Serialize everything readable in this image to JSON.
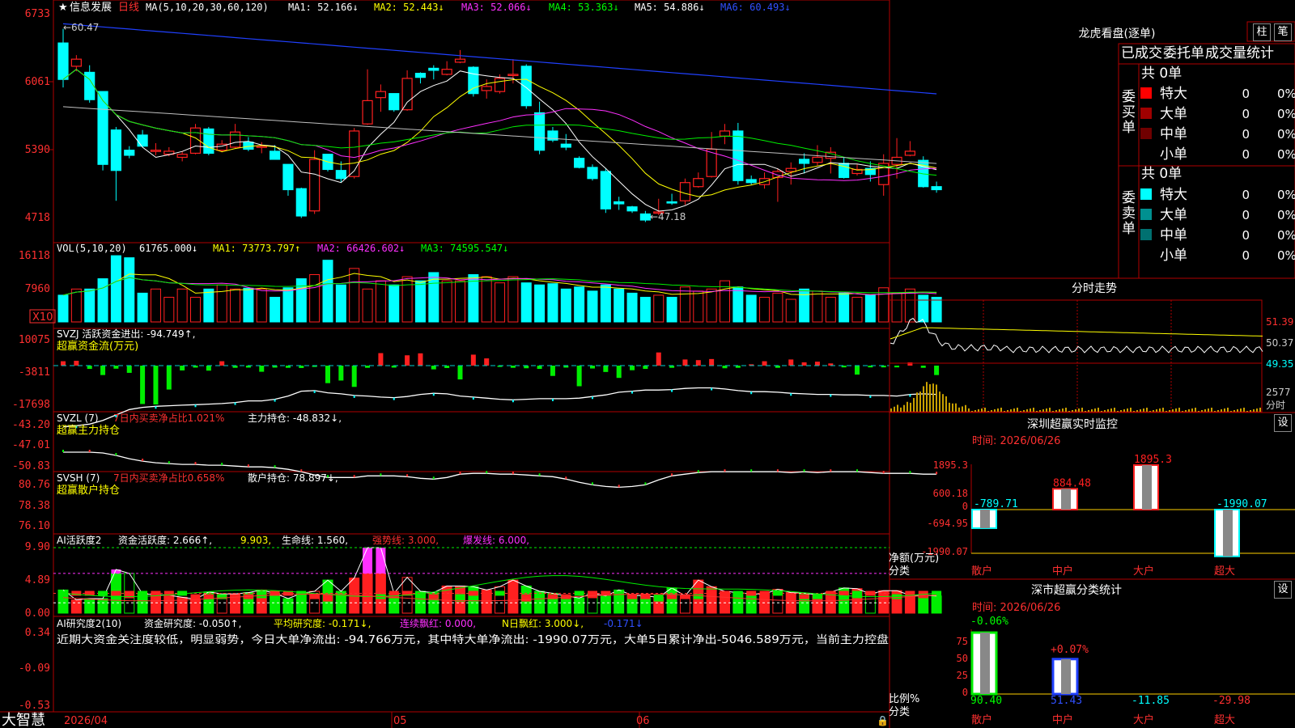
{
  "colors": {
    "up": "#ff2020",
    "down": "#00ffff",
    "green": "#00ee00",
    "magenta": "#ff30ff",
    "yellow": "#ffff00",
    "grid": "#b00000",
    "bg": "#000000"
  },
  "bottom_bar": {
    "brand": "大智慧",
    "date_start": "2026/04",
    "month_05": "05",
    "month_06": "06"
  },
  "main_chart": {
    "legend": {
      "star": "★",
      "name": "信息发展",
      "period": "日线",
      "ma_def": "MA(5,10,20,30,60,120)",
      "ma1": "MA1: 52.166↓",
      "ma2": "MA2: 52.443↓",
      "ma3": "MA3: 52.066↓",
      "ma4": "MA4: 53.363↓",
      "ma5": "MA5: 54.886↓",
      "ma6": "MA6: 60.493↓"
    },
    "y_ticks": [
      "6733",
      "6061",
      "5390",
      "4718"
    ],
    "high_label": "←60.47",
    "low_label": "←47.18"
  },
  "vol_chart": {
    "legend": {
      "def": "VOL(5,10,20)",
      "vol": "61765.000↓",
      "ma1": "MA1: 73773.797↑",
      "ma2": "MA2: 66426.602↓",
      "ma3": "MA3: 74595.547↓"
    },
    "y_ticks": [
      "16118",
      "7960"
    ],
    "unit": "X10"
  },
  "svzj": {
    "legend1": "SVZJ  活跃资金进出: -94.749↑,",
    "legend2": "超赢资金流(万元)",
    "y_ticks": [
      "10075",
      "-3811",
      "-17698"
    ]
  },
  "svzl": {
    "legend1_a": "SVZL (7)",
    "legend1_b": "7日内买卖净占比1.021%",
    "legend1_c": "主力持仓: -48.832↓,",
    "legend2": "超赢主力持仓",
    "y_ticks": [
      "-43.20",
      "-47.01",
      "-50.83"
    ]
  },
  "svsh": {
    "legend1_a": "SVSH (7)",
    "legend1_b": "7日内买卖净占比0.658%",
    "legend1_c": "散户持仓: 78.897↓,",
    "legend2": "超赢散户持仓",
    "y_ticks": [
      "80.76",
      "78.38",
      "76.10"
    ]
  },
  "ai2": {
    "l_a": "AI活跃度2",
    "l_b": "资金活跃度: 2.666↑,",
    "l_c": "9.903,",
    "l_d": "生命线: 1.560,",
    "l_e": "强势线: 3.000,",
    "l_f": "爆发线: 6.000,",
    "y_ticks": [
      "9.90",
      "4.89",
      "0.00"
    ]
  },
  "ai_res": {
    "l_a": "AI研究度2(10)",
    "l_b": "资金研究度: -0.050↑,",
    "l_c": "平均研究度: -0.171↓,",
    "l_d": "连续飘红: 0.000,",
    "l_e": "N日飘红: 3.000↓,",
    "l_f": "-0.171↓",
    "note": "近期大资金关注度较低，明显弱势，今日大单净流出: -94.766万元，其中特大单净流出: -1990.07万元，大单5日累计净出-5046.589万元，当前主力控盘",
    "y_ticks": [
      "0.34",
      "-0.09",
      "-0.53"
    ]
  },
  "right_panel": {
    "title": "龙虎看盘(逐单)",
    "btn_zhu": "柱",
    "btn_bi": "笔",
    "tabs": [
      "已成交",
      "委托单",
      "成交量统计"
    ],
    "buy": {
      "side": "委买单",
      "total": "共 0单",
      "rows": [
        {
          "name": "特大",
          "count": "0",
          "pct": "0%",
          "color": "#ff0000"
        },
        {
          "name": "大单",
          "count": "0",
          "pct": "0%",
          "color": "#a00000"
        },
        {
          "name": "中单",
          "count": "0",
          "pct": "0%",
          "color": "#700000"
        },
        {
          "name": "小单",
          "count": "0",
          "pct": "0%",
          "color": ""
        }
      ]
    },
    "sell": {
      "side": "委卖单",
      "total": "共 0单",
      "rows": [
        {
          "name": "特大",
          "count": "0",
          "pct": "0%",
          "color": "#00ffff"
        },
        {
          "name": "大单",
          "count": "0",
          "pct": "0%",
          "color": "#009090"
        },
        {
          "name": "中单",
          "count": "0",
          "pct": "0%",
          "color": "#007070"
        },
        {
          "name": "小单",
          "count": "0",
          "pct": "0%",
          "color": ""
        }
      ]
    },
    "intraday": {
      "title": "分时走势",
      "prices": [
        "51.39",
        "50.37",
        "49.35"
      ],
      "vol": "2577",
      "vol_unit": "分时"
    },
    "monitor": {
      "title": "深圳超赢实时监控",
      "date": "时间: 2026/06/26",
      "btn": "设",
      "y_ticks": [
        "1895.3",
        "600.18",
        "0",
        "-694.95",
        "-1990.07"
      ],
      "ylabel": "净额(万元)",
      "xlabel": "分类",
      "cats": [
        "散户",
        "中户",
        "大户",
        "超大"
      ],
      "values": [
        -789.71,
        884.48,
        1895.3,
        -1990.07
      ],
      "value_labels": [
        "-789.71",
        "884.48",
        "1895.3",
        "-1990.07"
      ]
    },
    "classify": {
      "title": "深市超赢分类统计",
      "date": "时间: 2026/06/26",
      "btn": "设",
      "y_ticks": [
        "75",
        "50",
        "25",
        "0"
      ],
      "ylabel": "比例%",
      "xlabel": "分类",
      "cats": [
        "散户",
        "中户",
        "大户",
        "超大"
      ],
      "top_labels": [
        "-0.06%",
        "+0.07%"
      ],
      "values": [
        "90.40",
        "51.43",
        "-11.85",
        "-29.98"
      ]
    }
  },
  "chart_data": [
    {
      "type": "candlestick",
      "title": "信息发展 日线",
      "y_ticks": [
        6733,
        6061,
        5390,
        4718
      ],
      "high": 60.47,
      "low": 47.18,
      "ohlc": [
        [
          64.6,
          66.0,
          60.2,
          61.0
        ],
        [
          62.3,
          63.4,
          61.8,
          63.0
        ],
        [
          61.7,
          62.4,
          58.7,
          59.0
        ],
        [
          59.8,
          59.8,
          52.0,
          52.6
        ],
        [
          56.0,
          56.3,
          49.0,
          52.0
        ],
        [
          54.0,
          54.4,
          53.2,
          53.5
        ],
        [
          55.5,
          56.0,
          54.3,
          54.4
        ],
        [
          54.0,
          54.7,
          53.5,
          54.0
        ],
        [
          53.6,
          54.3,
          53.4,
          53.9
        ],
        [
          53.3,
          53.9,
          52.9,
          53.6
        ],
        [
          53.7,
          56.6,
          53.6,
          56.2
        ],
        [
          56.1,
          56.3,
          53.5,
          53.7
        ],
        [
          54.0,
          55.0,
          53.8,
          54.6
        ],
        [
          54.3,
          56.6,
          54.2,
          55.8
        ],
        [
          54.8,
          55.3,
          53.9,
          54.1
        ],
        [
          54.3,
          54.8,
          53.7,
          54.4
        ],
        [
          53.9,
          54.5,
          53.1,
          53.1
        ],
        [
          52.6,
          52.6,
          49.5,
          50.1
        ],
        [
          50.2,
          50.3,
          47.3,
          47.5
        ],
        [
          48.0,
          54.0,
          47.7,
          53.1
        ],
        [
          53.6,
          53.6,
          51.9,
          52.1
        ],
        [
          52.0,
          52.9,
          50.8,
          51.2
        ],
        [
          51.4,
          56.2,
          51.2,
          55.9
        ],
        [
          56.6,
          62.0,
          56.5,
          58.9
        ],
        [
          59.2,
          60.5,
          57.8,
          59.8
        ],
        [
          59.6,
          59.6,
          57.8,
          58.0
        ],
        [
          58.0,
          61.9,
          57.9,
          61.1
        ],
        [
          61.6,
          61.7,
          60.6,
          61.2
        ],
        [
          62.1,
          62.4,
          61.0,
          61.9
        ],
        [
          61.5,
          62.8,
          61.4,
          62.0
        ],
        [
          62.7,
          63.9,
          62.6,
          63.0
        ],
        [
          62.2,
          62.3,
          59.3,
          59.6
        ],
        [
          59.9,
          61.0,
          59.1,
          60.3
        ],
        [
          59.8,
          61.5,
          59.6,
          61.1
        ],
        [
          61.4,
          63.0,
          60.6,
          61.5
        ],
        [
          62.3,
          62.5,
          58.1,
          58.4
        ],
        [
          57.7,
          58.8,
          53.6,
          54.0
        ],
        [
          55.9,
          56.3,
          54.8,
          55.0
        ],
        [
          54.6,
          55.6,
          54.0,
          54.3
        ],
        [
          53.2,
          53.4,
          52.2,
          52.3
        ],
        [
          52.3,
          52.6,
          51.0,
          51.2
        ],
        [
          51.9,
          52.2,
          47.8,
          48.2
        ],
        [
          48.9,
          49.4,
          48.1,
          48.7
        ],
        [
          48.4,
          48.5,
          47.8,
          48.0
        ],
        [
          47.7,
          48.0,
          46.9,
          47.1
        ],
        [
          47.9,
          49.2,
          47.6,
          47.9
        ],
        [
          48.9,
          49.7,
          48.6,
          48.8
        ],
        [
          49.0,
          51.2,
          48.6,
          50.8
        ],
        [
          50.4,
          51.8,
          50.3,
          51.2
        ],
        [
          51.4,
          55.8,
          51.3,
          54.1
        ],
        [
          55.4,
          56.6,
          54.6,
          55.9
        ],
        [
          55.9,
          56.7,
          50.6,
          51.0
        ],
        [
          51.1,
          51.5,
          50.6,
          50.8
        ],
        [
          50.6,
          51.8,
          50.2,
          51.2
        ],
        [
          51.3,
          52.2,
          48.9,
          51.9
        ],
        [
          51.9,
          52.8,
          50.6,
          52.2
        ],
        [
          53.1,
          53.7,
          51.7,
          52.7
        ],
        [
          52.8,
          54.5,
          52.5,
          53.3
        ],
        [
          53.2,
          54.3,
          51.7,
          53.8
        ],
        [
          52.7,
          53.3,
          51.2,
          51.3
        ],
        [
          51.7,
          52.6,
          51.5,
          52.1
        ],
        [
          52.2,
          52.9,
          50.9,
          51.6
        ],
        [
          50.6,
          53.6,
          49.5,
          52.7
        ],
        [
          52.6,
          55.2,
          51.2,
          53.3
        ],
        [
          53.5,
          54.9,
          53.4,
          53.9
        ],
        [
          53.0,
          53.4,
          50.3,
          50.4
        ],
        [
          50.4,
          50.9,
          49.8,
          50.1
        ]
      ]
    },
    {
      "type": "bar",
      "title": "VOL(5,10,20)",
      "y_ticks": [
        16118,
        7960
      ],
      "unit": "X10",
      "values": [
        6500,
        8000,
        8000,
        10500,
        16100,
        15600,
        7000,
        8000,
        6000,
        8000,
        6000,
        8000,
        9000,
        8000,
        8200,
        8000,
        6000,
        8300,
        10500,
        11500,
        15000,
        9000,
        13000,
        8000,
        10000,
        9000,
        11000,
        10000,
        12000,
        10000,
        10000,
        11500,
        11000,
        9500,
        11000,
        9500,
        9000,
        9300,
        8000,
        8500,
        7500,
        9000,
        8000,
        7000,
        6000,
        6500,
        6000,
        8500,
        7500,
        8000,
        10000,
        8500,
        6500,
        6000,
        7000,
        5500,
        8000,
        7500,
        6000,
        7000,
        6000,
        6500,
        8300,
        7000,
        8000,
        6500,
        6000
      ]
    },
    {
      "type": "bar",
      "title": "超赢资金流(万元)",
      "y_ticks": [
        10075,
        -3811,
        -17698
      ],
      "values": [
        2000,
        2200,
        -1500,
        -4300,
        -1400,
        -3300,
        -17500,
        -17700,
        -10900,
        -2200,
        -900,
        -2300,
        2000,
        -1000,
        -900,
        -2800,
        -900,
        -1000,
        -1100,
        -600,
        -8000,
        -6800,
        -9700,
        -1000,
        5700,
        -900,
        4700,
        5600,
        -1700,
        -1100,
        -6300,
        5000,
        3300,
        -600,
        -1000,
        -1200,
        -1500,
        -4700,
        -900,
        -9400,
        -1300,
        -2900,
        -5600,
        -2100,
        -1500,
        6000,
        -1000,
        2800,
        2500,
        3000,
        -1200,
        -1000,
        600,
        2000,
        -1000,
        2800,
        1500,
        1800,
        1000,
        -800,
        -4100,
        -800,
        -800,
        -800,
        1500,
        -1000,
        -4300
      ]
    },
    {
      "type": "line",
      "title": "超赢主力持仓",
      "y_ticks": [
        -43.2,
        -47.01,
        -50.83
      ],
      "series": [
        {
          "name": "主力持仓",
          "values": [
            -42.8,
            -43.0,
            -43.3,
            -44.0,
            -45.0,
            -46.0,
            -46.4,
            -46.6,
            -46.7,
            -46.8,
            -46.9,
            -47.0,
            -47.1,
            -47.3,
            -47.6,
            -47.6,
            -47.9,
            -48.5,
            -49.4,
            -49.5,
            -49.1,
            -48.9,
            -48.6,
            -48.5,
            -48.3,
            -48.2,
            -48.4,
            -48.8,
            -49.0,
            -48.9,
            -48.5,
            -48.3,
            -48.1,
            -47.9,
            -47.8,
            -47.9,
            -48.0,
            -48.0,
            -48.0,
            -48.1,
            -48.4,
            -48.7,
            -49.2,
            -49.4,
            -49.6,
            -49.6,
            -49.7,
            -49.9,
            -50.0,
            -50.0,
            -49.8,
            -49.5,
            -49.3,
            -49.3,
            -49.2,
            -49.0,
            -48.9,
            -48.8,
            -48.8,
            -48.7,
            -48.7,
            -48.6,
            -48.6,
            -48.5,
            -48.8,
            -48.9,
            -48.8
          ]
        }
      ]
    },
    {
      "type": "line",
      "title": "超赢散户持仓",
      "y_ticks": [
        80.76,
        78.38,
        76.1
      ],
      "series": [
        {
          "name": "散户持仓",
          "values": [
            76.2,
            76.2,
            76.2,
            76.3,
            76.6,
            77.0,
            77.3,
            77.5,
            77.6,
            77.7,
            77.7,
            77.8,
            77.8,
            77.9,
            78.0,
            78.0,
            78.1,
            78.3,
            78.6,
            79.0,
            79.3,
            79.3,
            79.3,
            79.1,
            79.1,
            79.1,
            79.2,
            79.4,
            79.5,
            79.3,
            78.9,
            78.8,
            78.8,
            78.9,
            78.9,
            79.0,
            79.1,
            79.2,
            79.5,
            79.9,
            80.2,
            80.4,
            80.5,
            80.4,
            80.2,
            79.6,
            79.1,
            78.9,
            78.7,
            78.6,
            78.6,
            78.6,
            78.6,
            78.6,
            78.6,
            78.7,
            78.6,
            78.7,
            78.6,
            78.6,
            78.6,
            78.7,
            78.8,
            78.8,
            78.8,
            78.9,
            78.9
          ]
        }
      ]
    },
    {
      "type": "bar",
      "title": "AI活跃度2",
      "y_ticks": [
        9.9,
        4.89,
        0.0
      ],
      "reference_lines": {
        "生命线": 1.56,
        "强势线": 3.0,
        "爆发线": 6.0
      },
      "values": [
        3.5,
        2.0,
        2.2,
        2.2,
        6.6,
        6.0,
        2.9,
        2.8,
        2.7,
        2.4,
        2.1,
        3.2,
        2.9,
        2.9,
        3.1,
        3.5,
        3.0,
        2.2,
        3.0,
        3.3,
        5.0,
        3.3,
        5.3,
        9.9,
        9.9,
        3.0,
        5.4,
        3.3,
        3.1,
        4.1,
        4.1,
        4.0,
        3.5,
        4.0,
        5.0,
        4.1,
        3.3,
        3.0,
        2.6,
        2.3,
        3.0,
        2.6,
        3.5,
        2.7,
        2.6,
        2.4,
        3.8,
        2.6,
        5.0,
        4.0,
        3.3,
        3.1,
        2.9,
        2.9,
        3.6,
        3.1,
        3.0,
        2.8,
        3.2,
        3.8,
        3.7,
        2.9,
        3.4,
        3.4,
        2.7,
        2.7,
        2.6
      ]
    },
    {
      "type": "bar",
      "title": "AI研究度2(10)",
      "y_ticks": [
        0.34,
        -0.09,
        -0.53
      ],
      "values": [
        -0.1,
        -0.1,
        -0.1,
        -0.1,
        -0.1,
        -0.1,
        -0.1,
        -0.1,
        -0.1,
        -0.1,
        -0.06,
        -0.06,
        -0.06,
        -0.06,
        -0.06,
        -0.1,
        -0.1,
        -0.1,
        -0.1,
        -0.06,
        -0.06,
        -0.06,
        -0.06,
        -0.06,
        -0.06,
        -0.1,
        -0.1,
        -0.06,
        -0.06,
        -0.06,
        -0.06,
        -0.1,
        -0.1,
        -0.1,
        -0.1,
        -0.06,
        -0.06,
        -0.06,
        -0.06,
        -0.1,
        -0.1,
        -0.1,
        -0.1,
        -0.06,
        -0.06,
        -0.06,
        -0.06,
        -0.06,
        -0.06,
        -0.1,
        -0.1,
        -0.1,
        -0.1,
        -0.1,
        -0.1,
        -0.06,
        -0.06,
        -0.06,
        -0.1,
        -0.1,
        -0.1,
        -0.1,
        -0.06,
        -0.06,
        -0.1,
        -0.1,
        -0.1
      ]
    }
  ]
}
